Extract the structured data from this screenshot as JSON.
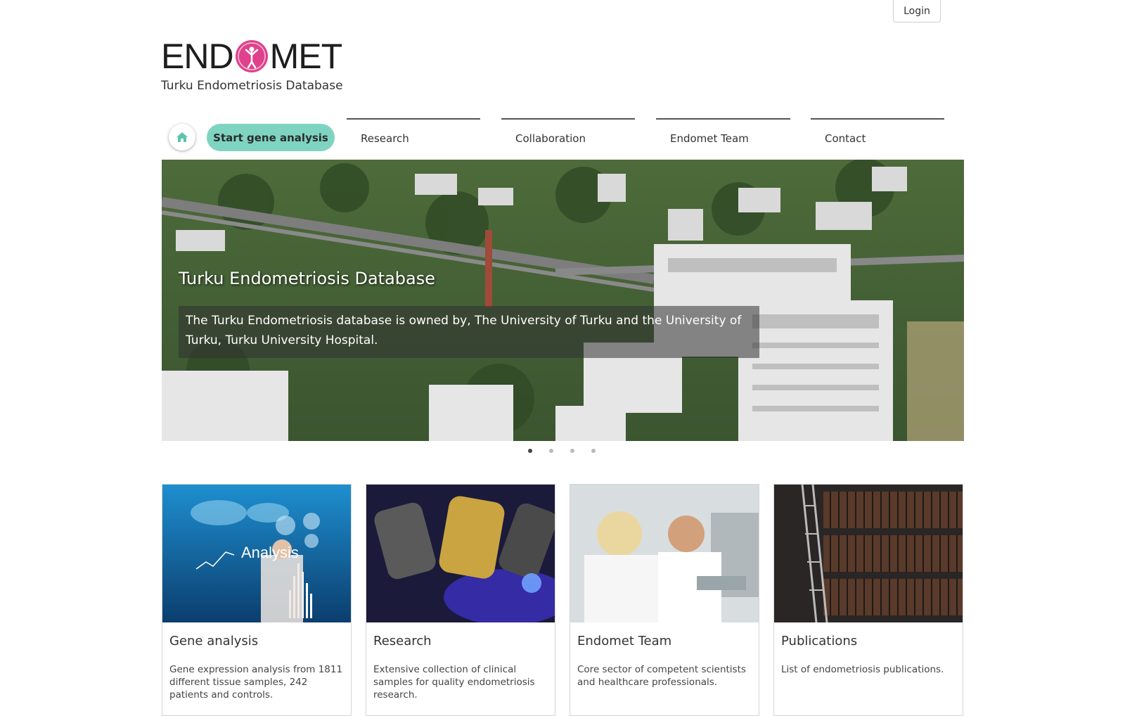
{
  "header": {
    "login_label": "Login",
    "logo_text_left": "END",
    "logo_text_right": "MET",
    "subtitle": "Turku Endometriosis Database"
  },
  "nav": {
    "home_icon": "home-icon",
    "start_button": "Start gene analysis",
    "items": [
      "Research",
      "Collaboration",
      "Endomet Team",
      "Contact"
    ]
  },
  "hero": {
    "title": "Turku Endometriosis Database",
    "caption": "The Turku Endometriosis database is owned by, The University of Turku and the University of Turku, Turku University Hospital.",
    "slide_count": 4,
    "active_slide": 1
  },
  "cards": [
    {
      "title": "Gene analysis",
      "text": "Gene expression analysis from 1811 different tissue samples, 242 patients and controls.",
      "image_label": "Analysis"
    },
    {
      "title": "Research",
      "text": "Extensive collection of clinical samples for quality endometriosis research."
    },
    {
      "title": "Endomet Team",
      "text": "Core sector of competent scientists and healthcare professionals."
    },
    {
      "title": "Publications",
      "text": "List of endometriosis publications."
    }
  ],
  "colors": {
    "accent": "#7fd4c1",
    "logo_pink": "#e0418c"
  }
}
